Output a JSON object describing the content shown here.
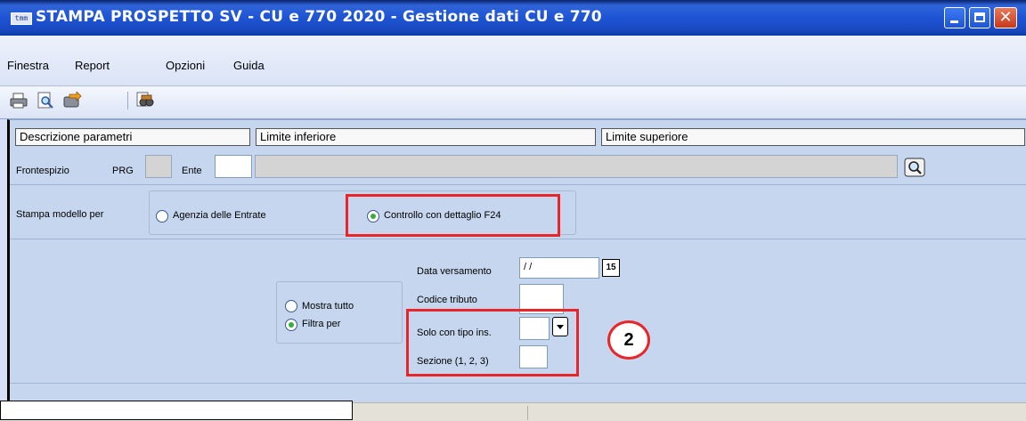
{
  "window": {
    "app_icon_text": "tmm",
    "title": "STAMPA PROSPETTO SV - CU e 770 2020 - Gestione dati CU e 770"
  },
  "menu": [
    "Finestra",
    "Report",
    "Opzioni",
    "Guida"
  ],
  "toolbar": [
    "print-icon",
    "print-preview-icon",
    "export-icon",
    "search-binoculars-icon"
  ],
  "columns": {
    "descrizione": "Descrizione parametri",
    "inferiore": "Limite inferiore",
    "superiore": "Limite superiore"
  },
  "frontespizio": {
    "label": "Frontespizio",
    "prg_label": "PRG",
    "prg_value": "",
    "ente_label": "Ente",
    "ente_value": "",
    "desc_value": ""
  },
  "stampa": {
    "label": "Stampa modello per",
    "options": [
      {
        "label": "Agenzia delle Entrate",
        "selected": false
      },
      {
        "label": "Controllo con dettaglio F24",
        "selected": true
      }
    ]
  },
  "filtro": {
    "options": [
      {
        "label": "Mostra tutto",
        "selected": false
      },
      {
        "label": "Filtra per",
        "selected": true
      }
    ],
    "data_versamento_label": "Data versamento",
    "data_versamento_value": " / /",
    "calendar_text": "15",
    "codice_tributo_label": "Codice tributo",
    "codice_tributo_value": "",
    "solo_tipo_label": "Solo con tipo ins.",
    "solo_tipo_value": "",
    "sezione_label": "Sezione (1, 2, 3)",
    "sezione_value": ""
  },
  "callout": "2",
  "colors": {
    "highlight": "#e8262a",
    "title_bar": "#1e54d4",
    "panel": "#c5d6ee"
  }
}
